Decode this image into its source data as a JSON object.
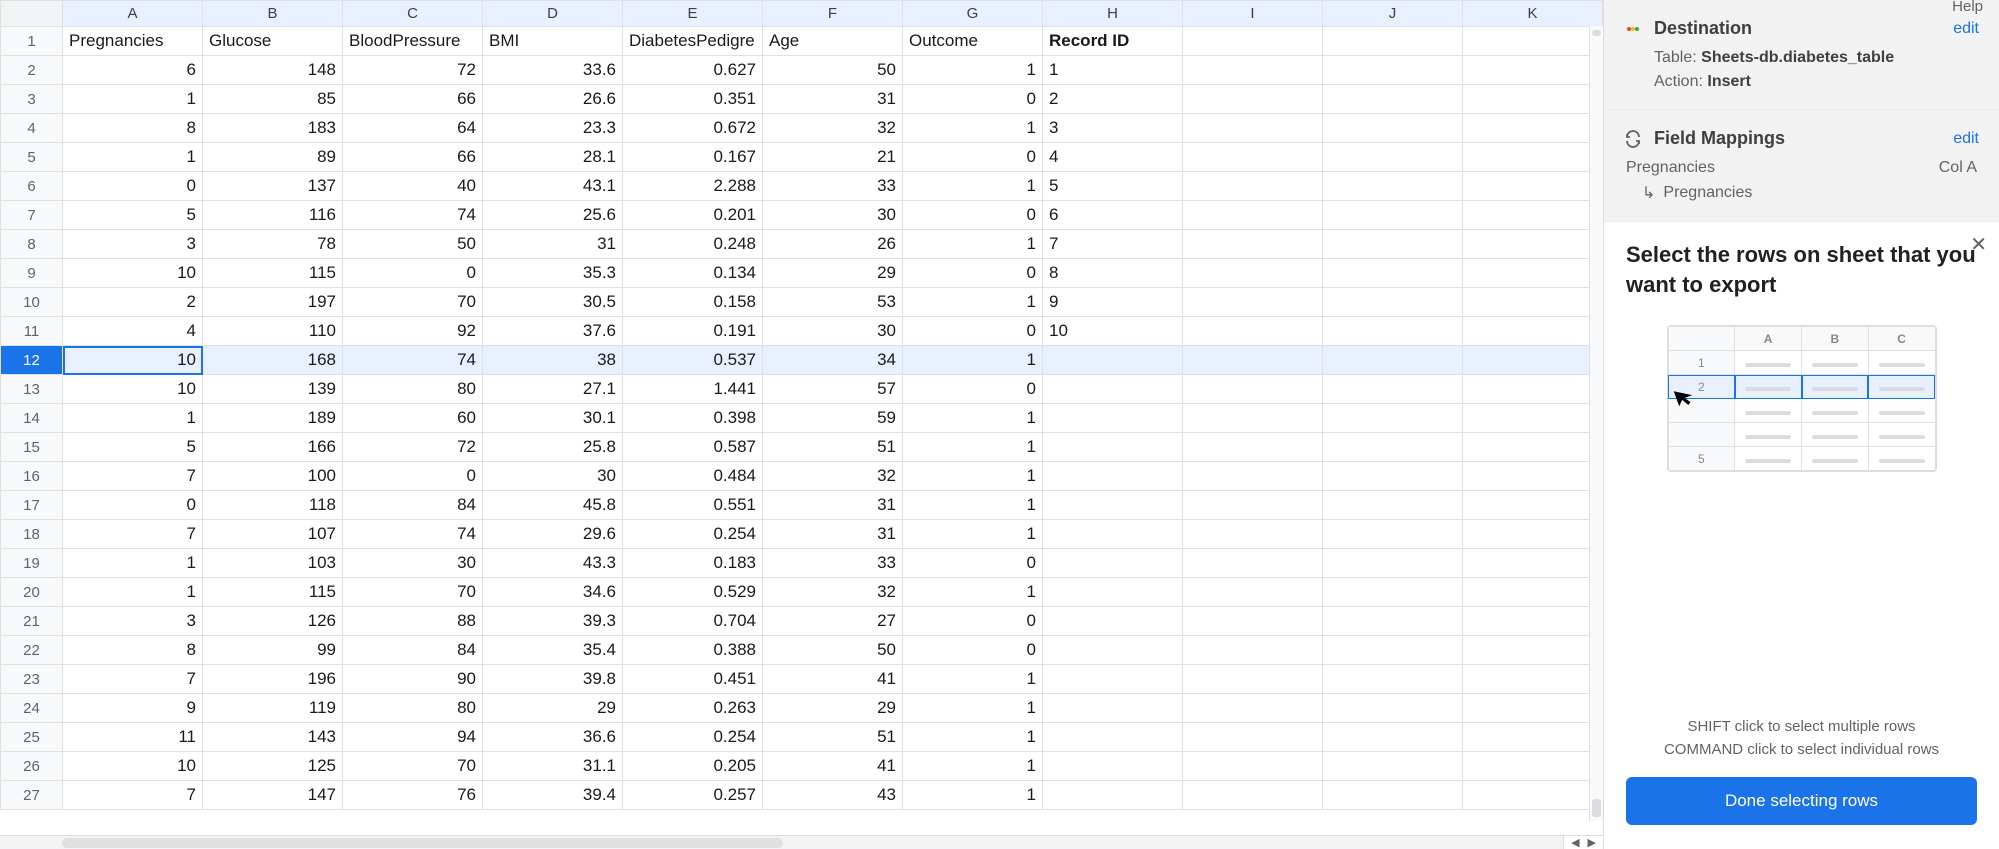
{
  "menu": {
    "help": "Help"
  },
  "columns": [
    "A",
    "B",
    "C",
    "D",
    "E",
    "F",
    "G",
    "H",
    "I",
    "J",
    "K"
  ],
  "headers": [
    "Pregnancies",
    "Glucose",
    "BloodPressure",
    "BMI",
    "DiabetesPedigree",
    "Age",
    "Outcome",
    "Record ID"
  ],
  "selected_row": 12,
  "rows": [
    {
      "r": 1,
      "cells": [
        "Pregnancies",
        "Glucose",
        "BloodPressure",
        "BMI",
        "DiabetesPedigre",
        "Age",
        "Outcome",
        "Record ID"
      ],
      "text": true,
      "boldCol": 7
    },
    {
      "r": 2,
      "cells": [
        "6",
        "148",
        "72",
        "33.6",
        "0.627",
        "50",
        "1",
        "1"
      ]
    },
    {
      "r": 3,
      "cells": [
        "1",
        "85",
        "66",
        "26.6",
        "0.351",
        "31",
        "0",
        "2"
      ]
    },
    {
      "r": 4,
      "cells": [
        "8",
        "183",
        "64",
        "23.3",
        "0.672",
        "32",
        "1",
        "3"
      ]
    },
    {
      "r": 5,
      "cells": [
        "1",
        "89",
        "66",
        "28.1",
        "0.167",
        "21",
        "0",
        "4"
      ]
    },
    {
      "r": 6,
      "cells": [
        "0",
        "137",
        "40",
        "43.1",
        "2.288",
        "33",
        "1",
        "5"
      ]
    },
    {
      "r": 7,
      "cells": [
        "5",
        "116",
        "74",
        "25.6",
        "0.201",
        "30",
        "0",
        "6"
      ]
    },
    {
      "r": 8,
      "cells": [
        "3",
        "78",
        "50",
        "31",
        "0.248",
        "26",
        "1",
        "7"
      ]
    },
    {
      "r": 9,
      "cells": [
        "10",
        "115",
        "0",
        "35.3",
        "0.134",
        "29",
        "0",
        "8"
      ]
    },
    {
      "r": 10,
      "cells": [
        "2",
        "197",
        "70",
        "30.5",
        "0.158",
        "53",
        "1",
        "9"
      ]
    },
    {
      "r": 11,
      "cells": [
        "4",
        "110",
        "92",
        "37.6",
        "0.191",
        "30",
        "0",
        "10"
      ]
    },
    {
      "r": 12,
      "cells": [
        "10",
        "168",
        "74",
        "38",
        "0.537",
        "34",
        "1",
        ""
      ]
    },
    {
      "r": 13,
      "cells": [
        "10",
        "139",
        "80",
        "27.1",
        "1.441",
        "57",
        "0",
        ""
      ]
    },
    {
      "r": 14,
      "cells": [
        "1",
        "189",
        "60",
        "30.1",
        "0.398",
        "59",
        "1",
        ""
      ]
    },
    {
      "r": 15,
      "cells": [
        "5",
        "166",
        "72",
        "25.8",
        "0.587",
        "51",
        "1",
        ""
      ]
    },
    {
      "r": 16,
      "cells": [
        "7",
        "100",
        "0",
        "30",
        "0.484",
        "32",
        "1",
        ""
      ]
    },
    {
      "r": 17,
      "cells": [
        "0",
        "118",
        "84",
        "45.8",
        "0.551",
        "31",
        "1",
        ""
      ]
    },
    {
      "r": 18,
      "cells": [
        "7",
        "107",
        "74",
        "29.6",
        "0.254",
        "31",
        "1",
        ""
      ]
    },
    {
      "r": 19,
      "cells": [
        "1",
        "103",
        "30",
        "43.3",
        "0.183",
        "33",
        "0",
        ""
      ]
    },
    {
      "r": 20,
      "cells": [
        "1",
        "115",
        "70",
        "34.6",
        "0.529",
        "32",
        "1",
        ""
      ]
    },
    {
      "r": 21,
      "cells": [
        "3",
        "126",
        "88",
        "39.3",
        "0.704",
        "27",
        "0",
        ""
      ]
    },
    {
      "r": 22,
      "cells": [
        "8",
        "99",
        "84",
        "35.4",
        "0.388",
        "50",
        "0",
        ""
      ]
    },
    {
      "r": 23,
      "cells": [
        "7",
        "196",
        "90",
        "39.8",
        "0.451",
        "41",
        "1",
        ""
      ]
    },
    {
      "r": 24,
      "cells": [
        "9",
        "119",
        "80",
        "29",
        "0.263",
        "29",
        "1",
        ""
      ]
    },
    {
      "r": 25,
      "cells": [
        "11",
        "143",
        "94",
        "36.6",
        "0.254",
        "51",
        "1",
        ""
      ]
    },
    {
      "r": 26,
      "cells": [
        "10",
        "125",
        "70",
        "31.1",
        "0.205",
        "41",
        "1",
        ""
      ]
    },
    {
      "r": 27,
      "cells": [
        "7",
        "147",
        "76",
        "39.4",
        "0.257",
        "43",
        "1",
        ""
      ]
    }
  ],
  "sidebar": {
    "destination": {
      "title": "Destination",
      "edit": "edit",
      "table_key": "Table:",
      "table_val": "Sheets-db.diabetes_table",
      "action_key": "Action:",
      "action_val": "Insert"
    },
    "mappings": {
      "title": "Field Mappings",
      "edit": "edit",
      "field": "Pregnancies",
      "col": "Col A",
      "target": "Pregnancies"
    },
    "popup": {
      "title": "Select the rows on sheet that you want to export",
      "tip1": "SHIFT click to select multiple rows",
      "tip2": "COMMAND click to select individual rows",
      "button": "Done selecting rows",
      "demo_cols": [
        "A",
        "B",
        "C"
      ],
      "demo_rows": [
        "1",
        "2",
        "",
        "",
        "5"
      ]
    }
  }
}
